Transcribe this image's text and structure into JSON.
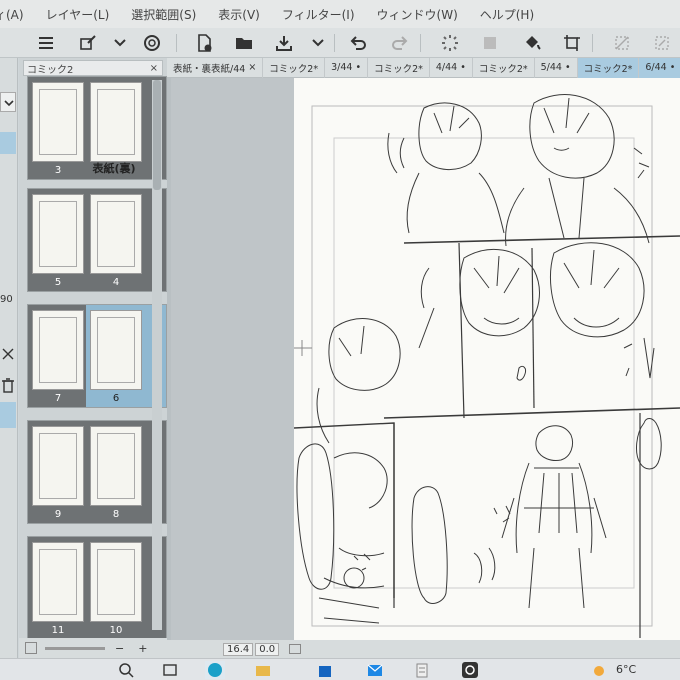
{
  "menu": [
    "ィ(A)",
    "レイヤー(L)",
    "選択範囲(S)",
    "表示(V)",
    "フィルター(I)",
    "ウィンドウ(W)",
    "ヘルプ(H)"
  ],
  "page_manager": {
    "tab_label": "コミック2",
    "close": "×",
    "spreads": [
      {
        "left": "3",
        "right": "表紙(裏)"
      },
      {
        "left": "5",
        "right": "4"
      },
      {
        "left": "7",
        "right": "6",
        "selected": true
      },
      {
        "left": "9",
        "right": "8"
      },
      {
        "left": "11",
        "right": "10"
      }
    ],
    "zoom_out": "−",
    "zoom_in": "+"
  },
  "doc_tabs": [
    {
      "label": "表紙・裏表紙/44",
      "close": "×"
    },
    {
      "label": "コミック2*"
    },
    {
      "label": "3/44"
    },
    {
      "label": "コミック2*"
    },
    {
      "label": "4/44"
    },
    {
      "label": "コミック2*"
    },
    {
      "label": "5/44"
    },
    {
      "label": "コミック2*",
      "active": true
    },
    {
      "label": "6/44"
    }
  ],
  "status": {
    "zoom": "16.4",
    "angle": "0.0"
  },
  "left_strip": {
    "value_fragment": "90"
  },
  "taskbar": {
    "temperature": "6°C"
  },
  "colors": {
    "selected_spread": "#8fb8d1",
    "active_tab": "#a9cbe0",
    "panel": "#cdd3d5"
  }
}
